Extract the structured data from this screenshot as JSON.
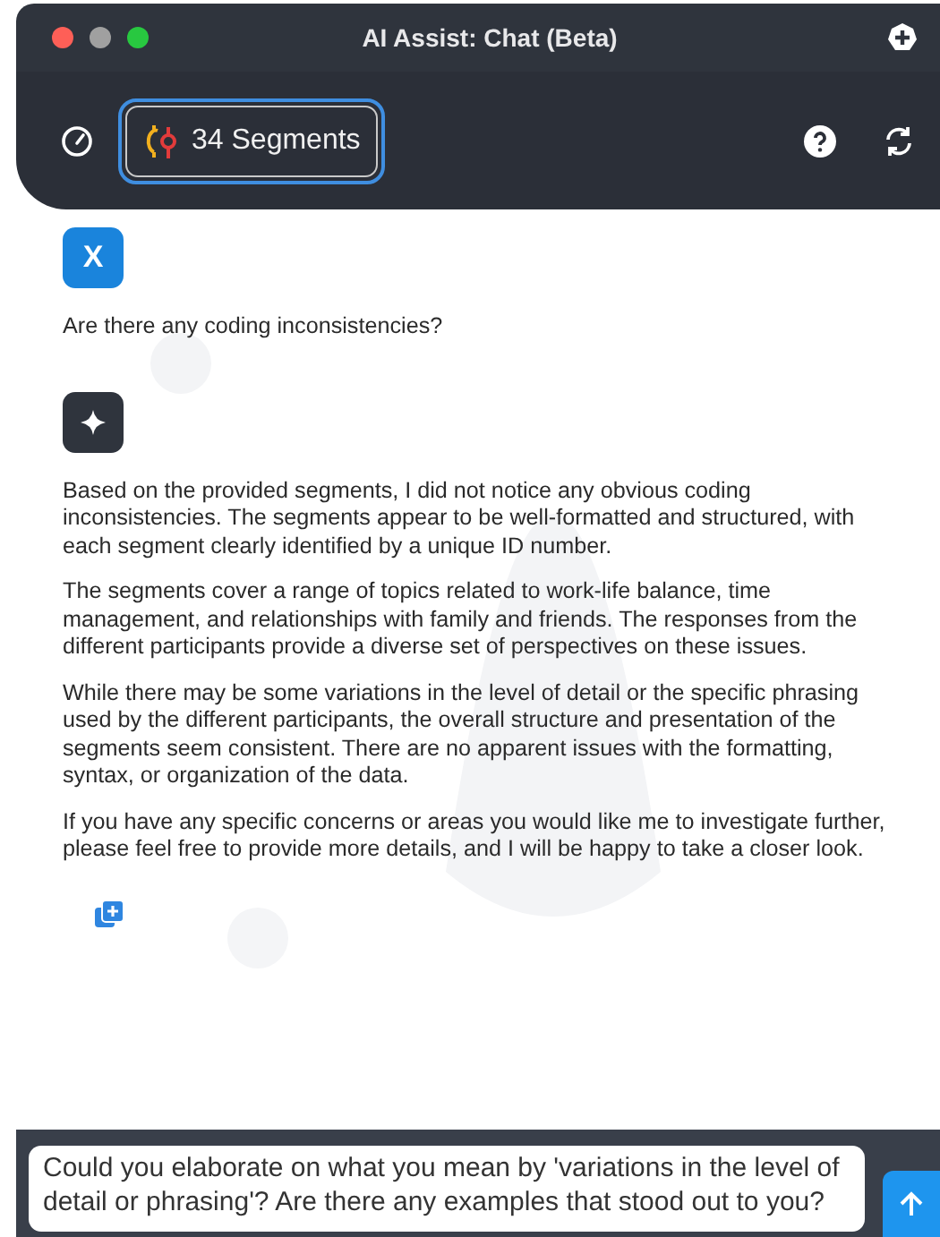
{
  "window": {
    "title": "AI Assist: Chat (Beta)"
  },
  "toolbar": {
    "segments_button": "34 Segments"
  },
  "messages": [
    {
      "kind": "user",
      "avatar": "X",
      "paragraphs": [
        "Are there any coding inconsistencies?"
      ]
    },
    {
      "kind": "assistant",
      "paragraphs": [
        "Based on the provided segments, I did not notice any obvious coding inconsistencies. The segments appear to be well-formatted and structured, with each segment clearly identified by a unique ID number.",
        "The segments cover a range of topics related to work-life balance, time management, and relationships with family and friends. The responses from the different participants provide a diverse set of perspectives on these issues.",
        "While there may be some variations in the level of detail or the specific phrasing used by the different participants, the overall structure and presentation of the segments seem consistent. There are no apparent issues with the formatting, syntax, or organization of the data.",
        "If you have any specific concerns or areas you would like me to investigate further, please feel free to provide more details, and I will be happy to take a closer look."
      ]
    }
  ],
  "composer": {
    "value": "Could you elaborate on what you mean by 'variations in the level of detail or phrasing'? Are there any examples that stood out to you?"
  }
}
